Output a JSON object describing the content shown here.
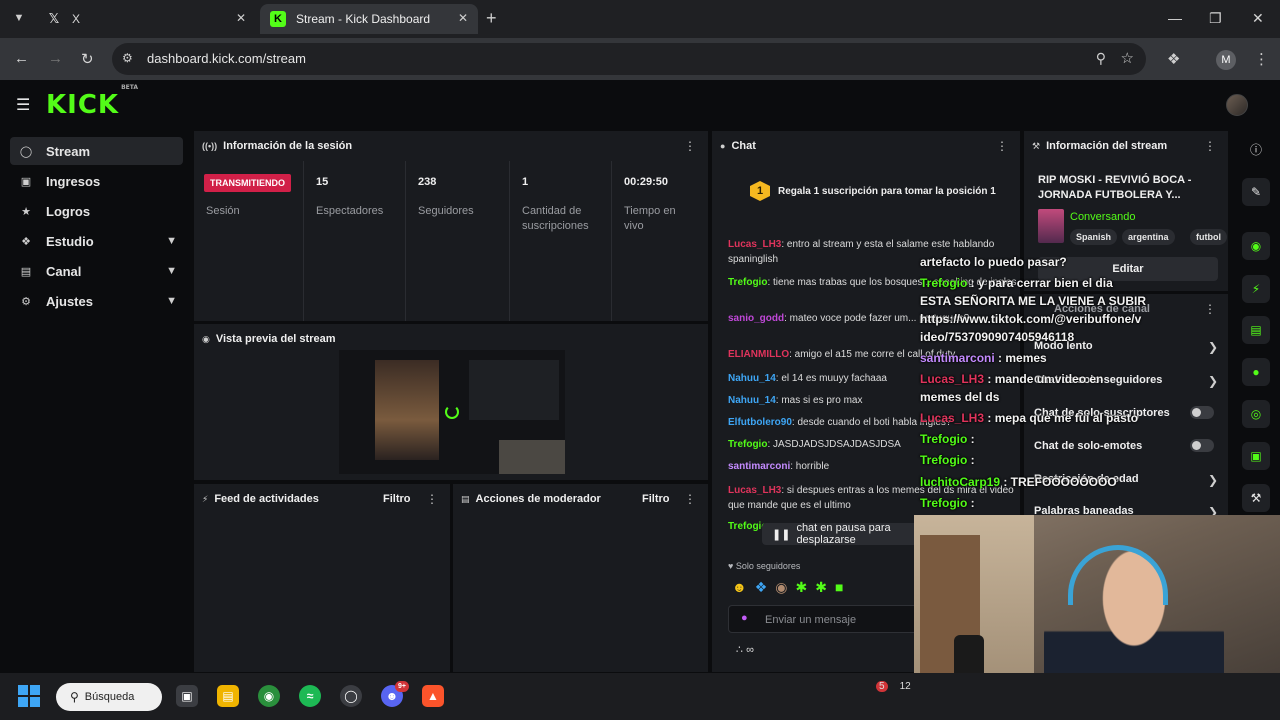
{
  "browser": {
    "tabs": [
      {
        "title": "X",
        "favicon": "x-logo"
      },
      {
        "title": "Stream - Kick Dashboard",
        "favicon": "kick-logo"
      }
    ],
    "url": "dashboard.kick.com/stream",
    "profile_initial": "M"
  },
  "header": {
    "logo": "KICK",
    "logo_badge": "BETA"
  },
  "sidebar": {
    "items": [
      {
        "label": "Stream",
        "icon": "stream-icon",
        "active": true
      },
      {
        "label": "Ingresos",
        "icon": "income-icon"
      },
      {
        "label": "Logros",
        "icon": "trophy-icon"
      },
      {
        "label": "Estudio",
        "icon": "studio-icon",
        "expandable": true
      },
      {
        "label": "Canal",
        "icon": "channel-icon",
        "expandable": true
      },
      {
        "label": "Ajustes",
        "icon": "gear-icon",
        "expandable": true
      }
    ]
  },
  "session": {
    "title": "Información de la sesión",
    "status_badge": "TRANSMITIENDO",
    "status_label": "Sesión",
    "stats": [
      {
        "value": "15",
        "label": "Espectadores"
      },
      {
        "value": "238",
        "label": "Seguidores"
      },
      {
        "value": "1",
        "label": "Cantidad de suscripciones"
      },
      {
        "value": "00:29:50",
        "label": "Tiempo en vivo"
      }
    ]
  },
  "preview": {
    "title": "Vista previa del stream"
  },
  "activity": {
    "title": "Feed de actividades",
    "filter": "Filtro"
  },
  "mod_actions": {
    "title": "Acciones de moderador",
    "filter": "Filtro"
  },
  "chat": {
    "title": "Chat",
    "sub_banner": {
      "badge": "1",
      "text": "Regala 1 suscripción para tomar la posición 1"
    },
    "messages": [
      {
        "user": "Lucas_LH3",
        "color": "#e0345c",
        "text": ": entro al stream y esta el salame este hablando spaninglish"
      },
      {
        "user": "Trefogio",
        "color": "#53fc18",
        "text": ": tiene mas trabas que los bosques... speaking de ingles"
      },
      {
        "user": "sanio_godd",
        "color": "#c048d8",
        "text": ": mateo voce pode fazer um... portugues?"
      },
      {
        "user": "ELIANMILLO",
        "color": "#e0345c",
        "text": ": amigo el a15 me corre el call of duty"
      },
      {
        "user": "Nahuu_14",
        "color": "#3ea6f5",
        "text": ": el 14 es muuyy fachaaa"
      },
      {
        "user": "Nahuu_14",
        "color": "#3ea6f5",
        "text": ": mas si es pro max"
      },
      {
        "user": "Elfutbolero90",
        "color": "#3ea6f5",
        "text": ": desde cuando el boti habla ingles?"
      },
      {
        "user": "Trefogio",
        "color": "#53fc18",
        "text": ": JASDJADSJDSAJDASJDSA"
      },
      {
        "user": "santimarconi",
        "color": "#c48bff",
        "text": ": horrible"
      },
      {
        "user": "Lucas_LH3",
        "color": "#e0345c",
        "text": ": si despues entras a los memes del ds mira el video que mande que es el ultimo"
      },
      {
        "user": "Trefogio",
        "color": "#53fc18",
        "text": ""
      }
    ],
    "pause_label": "chat en pausa para desplazarse",
    "only_followers": "Solo seguidores",
    "input_placeholder": "Enviar un mensaje"
  },
  "stream_info": {
    "title": "Información del stream",
    "stream_title": "RIP MOSKI - REVIVIÓ BOCA - JORNADA FUTBOLERA Y...",
    "category": "Conversando",
    "tags": [
      "Spanish",
      "argentina",
      "futbol"
    ],
    "edit_label": "Editar"
  },
  "channel_actions": {
    "title": "Acciones de canal",
    "rows": [
      {
        "label": "Modo lento",
        "type": "chevron"
      },
      {
        "label": "Chat de solo-seguidores",
        "type": "chevron"
      },
      {
        "label": "Chat de solo-suscriptores",
        "type": "toggle"
      },
      {
        "label": "Chat de solo-emotes",
        "type": "toggle"
      },
      {
        "label": "Restricción de edad",
        "type": "chevron"
      },
      {
        "label": "Palabras baneadas",
        "type": "chevron"
      }
    ]
  },
  "overlay_chat": [
    {
      "user": "",
      "color": "#f2f2f2",
      "text": "artefacto lo puedo pasar?"
    },
    {
      "user": "Trefogio",
      "color": "#53fc18",
      "text": " : y para cerrar bien el dia"
    },
    {
      "user": "",
      "color": "#f2f2f2",
      "text": "ESTA SEÑORITA ME LA VIENE A SUBIR"
    },
    {
      "user": "",
      "color": "#f2f2f2",
      "text": "https://www.tiktok.com/@veribuffone/v"
    },
    {
      "user": "",
      "color": "#f2f2f2",
      "text": "ideo/7537090907405946118"
    },
    {
      "user": "santimarconi",
      "color": "#c48bff",
      "text": " : memes"
    },
    {
      "user": "Lucas_LH3",
      "color": "#e0345c",
      "text": " : mande un video en"
    },
    {
      "user": "",
      "color": "#f2f2f2",
      "text": "memes del ds"
    },
    {
      "user": "Lucas_LH3",
      "color": "#e0345c",
      "text": " : mepa que me fui al pasto"
    },
    {
      "user": "Trefogio",
      "color": "#53fc18",
      "text": " :"
    },
    {
      "user": "Trefogio",
      "color": "#53fc18",
      "text": " :"
    },
    {
      "user": "luchitoCarp19",
      "color": "#53fc18",
      "text": " : TREFOOOOOOOO"
    },
    {
      "user": "Trefogio",
      "color": "#53fc18",
      "text": " :"
    }
  ],
  "taskbar": {
    "search_label": "Búsqueda",
    "discord_badge": "9+",
    "tray_badge": "5",
    "tray_time": "12"
  }
}
